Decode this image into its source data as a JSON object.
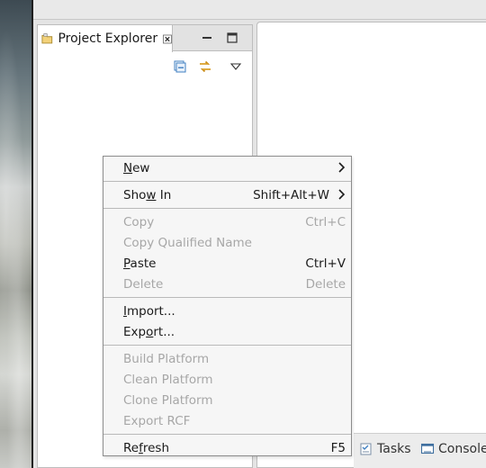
{
  "explorer": {
    "tab_label": "Project Explorer",
    "tab_icon": "folder-icon",
    "close_icon": "close-icon",
    "minimize_icon": "minimize-icon",
    "maximize_icon": "maximize-icon",
    "toolbar": [
      "collapse-all-icon",
      "link-with-editor-icon",
      "view-menu-chevron-icon"
    ]
  },
  "bottom_tabs": [
    {
      "label": "Tasks",
      "icon": "tasks-icon"
    },
    {
      "label": "Console",
      "icon": "console-icon"
    }
  ],
  "context_menu": {
    "items": [
      {
        "pre": "",
        "mn": "N",
        "post": "ew",
        "shortcut": "",
        "submenu": true,
        "enabled": true
      },
      {
        "pre": "Sho",
        "mn": "w",
        "post": " In",
        "shortcut": "Shift+Alt+W",
        "submenu": true,
        "enabled": true
      },
      {
        "label": "Copy",
        "shortcut": "Ctrl+C",
        "enabled": false
      },
      {
        "label": "Copy Qualified Name",
        "shortcut": "",
        "enabled": false
      },
      {
        "pre": "",
        "mn": "P",
        "post": "aste",
        "shortcut": "Ctrl+V",
        "enabled": true
      },
      {
        "label": "Delete",
        "shortcut": "Delete",
        "enabled": false
      },
      {
        "pre": "",
        "mn": "I",
        "post": "mport...",
        "shortcut": "",
        "enabled": true
      },
      {
        "pre": "Exp",
        "mn": "o",
        "post": "rt...",
        "shortcut": "",
        "enabled": true
      },
      {
        "label": "Build Platform",
        "shortcut": "",
        "enabled": false
      },
      {
        "label": "Clean Platform",
        "shortcut": "",
        "enabled": false
      },
      {
        "label": "Clone Platform",
        "shortcut": "",
        "enabled": false
      },
      {
        "label": "Export RCF",
        "shortcut": "",
        "enabled": false
      },
      {
        "pre": "Re",
        "mn": "f",
        "post": "resh",
        "shortcut": "F5",
        "enabled": true
      }
    ]
  },
  "colors": {
    "menu_bg": "#f6f6f6",
    "disabled_text": "#a7a7a7",
    "accent_icon": "#3f7fc1"
  }
}
